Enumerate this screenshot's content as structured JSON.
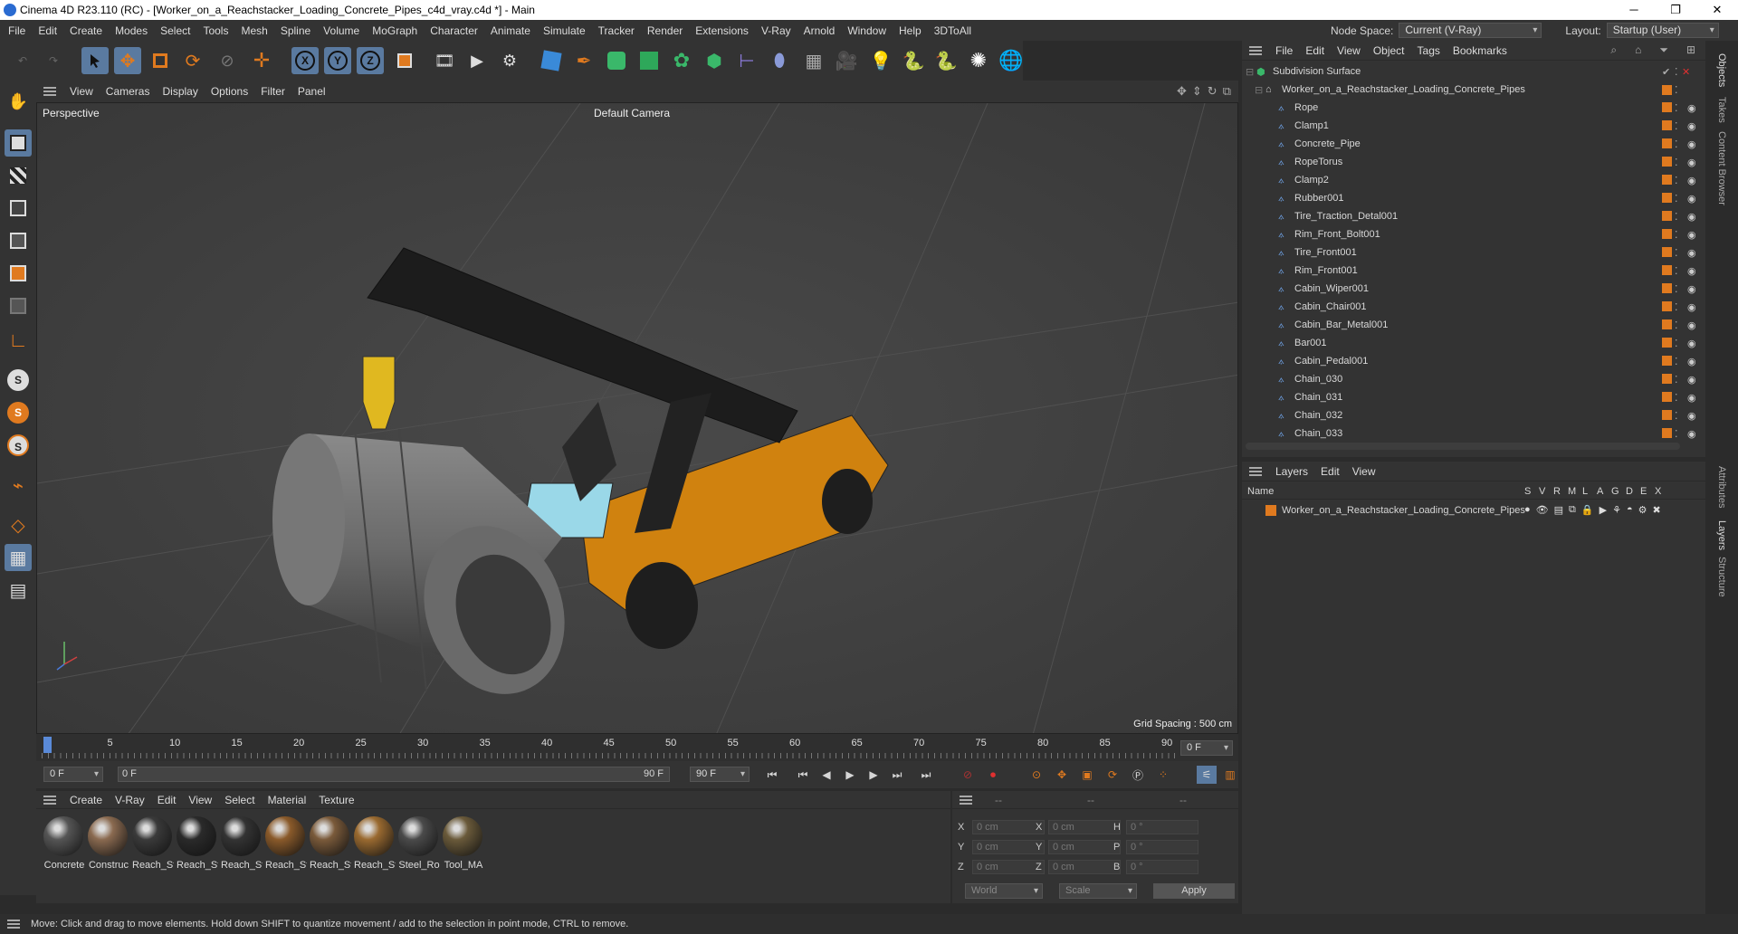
{
  "window": {
    "title": "Cinema 4D R23.110 (RC) - [Worker_on_a_Reachstacker_Loading_Concrete_Pipes_c4d_vray.c4d *] - Main"
  },
  "menu": [
    "File",
    "Edit",
    "Create",
    "Modes",
    "Select",
    "Tools",
    "Mesh",
    "Spline",
    "Volume",
    "MoGraph",
    "Character",
    "Animate",
    "Simulate",
    "Tracker",
    "Render",
    "Extensions",
    "V-Ray",
    "Arnold",
    "Window",
    "Help",
    "3DToAll"
  ],
  "nodespace": {
    "label": "Node Space:",
    "value": "Current (V-Ray)",
    "layout_label": "Layout:",
    "layout_value": "Startup (User)"
  },
  "viewport": {
    "menu": [
      "View",
      "Cameras",
      "Display",
      "Options",
      "Filter",
      "Panel"
    ],
    "name": "Perspective",
    "camera": "Default Camera",
    "grid": "Grid Spacing : 500 cm"
  },
  "timeline": {
    "ticks": [
      "0",
      "5",
      "10",
      "15",
      "20",
      "25",
      "30",
      "35",
      "40",
      "45",
      "50",
      "55",
      "60",
      "65",
      "70",
      "75",
      "80",
      "85",
      "90"
    ],
    "frame_right": "0 F"
  },
  "transport": {
    "start": "0 F",
    "current": "0 F",
    "end_inner": "90 F",
    "end": "90 F"
  },
  "materials": {
    "menu": [
      "Create",
      "V-Ray",
      "Edit",
      "View",
      "Select",
      "Material",
      "Texture"
    ],
    "items": [
      {
        "name": "Concrete",
        "color": "#555"
      },
      {
        "name": "Construc",
        "color": "#8a6a50"
      },
      {
        "name": "Reach_St",
        "color": "#3a3a3a"
      },
      {
        "name": "Reach_St",
        "color": "#2a2a2a"
      },
      {
        "name": "Reach_St",
        "color": "#333"
      },
      {
        "name": "Reach_St",
        "color": "#8a5a2a"
      },
      {
        "name": "Reach_St",
        "color": "#7a5a3a"
      },
      {
        "name": "Reach_St",
        "color": "#9a6a30"
      },
      {
        "name": "Steel_Ro",
        "color": "#4a4a4a"
      },
      {
        "name": "Tool_MA",
        "color": "#6a5a3a"
      }
    ]
  },
  "coords": {
    "dashes": [
      "--",
      "--",
      "--"
    ],
    "rows": [
      {
        "a": "X",
        "av": "0 cm",
        "b": "X",
        "bv": "0 cm",
        "c": "H",
        "cv": "0 °"
      },
      {
        "a": "Y",
        "av": "0 cm",
        "b": "Y",
        "bv": "0 cm",
        "c": "P",
        "cv": "0 °"
      },
      {
        "a": "Z",
        "av": "0 cm",
        "b": "Z",
        "bv": "0 cm",
        "c": "B",
        "cv": "0 °"
      }
    ],
    "world": "World",
    "scale": "Scale",
    "apply": "Apply"
  },
  "objects": {
    "menu": [
      "File",
      "Edit",
      "View",
      "Object",
      "Tags",
      "Bookmarks"
    ],
    "root": "Subdivision Surface",
    "group": "Worker_on_a_Reachstacker_Loading_Concrete_Pipes",
    "items": [
      "Rope",
      "Clamp1",
      "Concrete_Pipe",
      "RopeTorus",
      "Clamp2",
      "Rubber001",
      "Tire_Traction_Detal001",
      "Rim_Front_Bolt001",
      "Tire_Front001",
      "Rim_Front001",
      "Cabin_Wiper001",
      "Cabin_Chair001",
      "Cabin_Bar_Metal001",
      "Bar001",
      "Cabin_Pedal001",
      "Chain_030",
      "Chain_031",
      "Chain_032",
      "Chain_033"
    ]
  },
  "layers": {
    "menu": [
      "Layers",
      "Edit",
      "View"
    ],
    "name_header": "Name",
    "cols": [
      "S",
      "V",
      "R",
      "M",
      "L",
      "A",
      "G",
      "D",
      "E",
      "X"
    ],
    "item": "Worker_on_a_Reachstacker_Loading_Concrete_Pipes"
  },
  "right_tabs": [
    "Objects",
    "Takes",
    "Content Browser",
    "Attributes",
    "Layers",
    "Structure"
  ],
  "status": "Move: Click and drag to move elements. Hold down SHIFT to quantize movement / add to the selection in point mode, CTRL to remove.",
  "colors": {
    "accent": "#e07a1f",
    "panel": "#333333",
    "viewport": "#454545"
  }
}
